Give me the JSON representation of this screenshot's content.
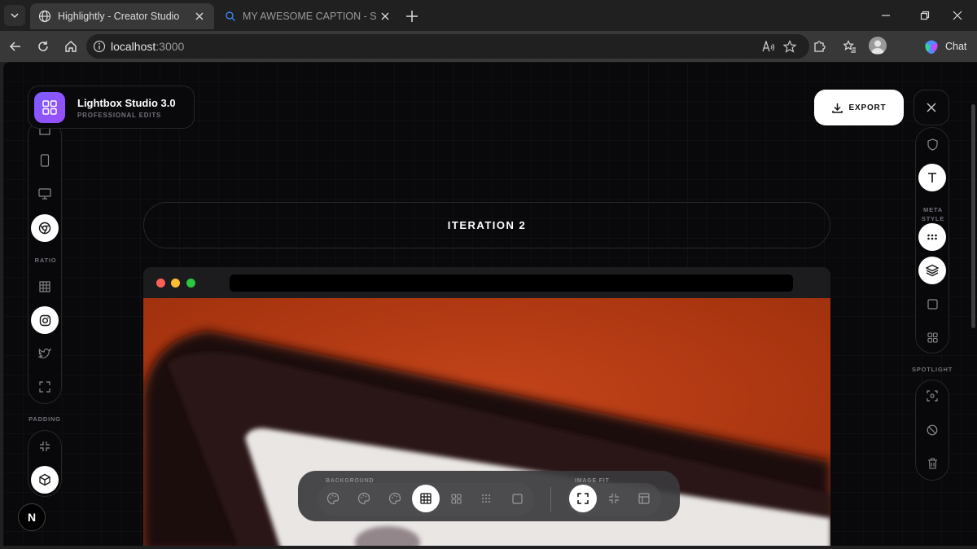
{
  "browser": {
    "tabs": [
      {
        "title": "Highlightly - Creator Studio",
        "active": true,
        "icon": "globe-icon"
      },
      {
        "title": "MY AWESOME CAPTION - Search",
        "active": false,
        "icon": "search-icon"
      }
    ],
    "address": {
      "host": "localhost",
      "port": ":3000"
    },
    "chat_label": "Chat"
  },
  "app": {
    "brand": {
      "title": "Lightbox Studio 3.0",
      "subtitle": "PROFESSIONAL EDITS"
    },
    "export_label": "EXPORT",
    "canvas_title": "ITERATION 2",
    "left_labels": {
      "ratio": "RATIO",
      "padding": "PADDING"
    },
    "right_labels": {
      "meta_style_1": "META",
      "meta_style_2": "STYLE",
      "spotlight": "SPOTLIGHT"
    },
    "dock_labels": {
      "background": "BACKGROUND",
      "image_fit": "IMAGE FIT"
    },
    "next_badge": "N"
  },
  "colors": {
    "accent": "#8b5cf6",
    "traffic_red": "#ff5f57",
    "traffic_yellow": "#febc2e",
    "traffic_green": "#28c840",
    "photo_orange": "#b23a12"
  }
}
